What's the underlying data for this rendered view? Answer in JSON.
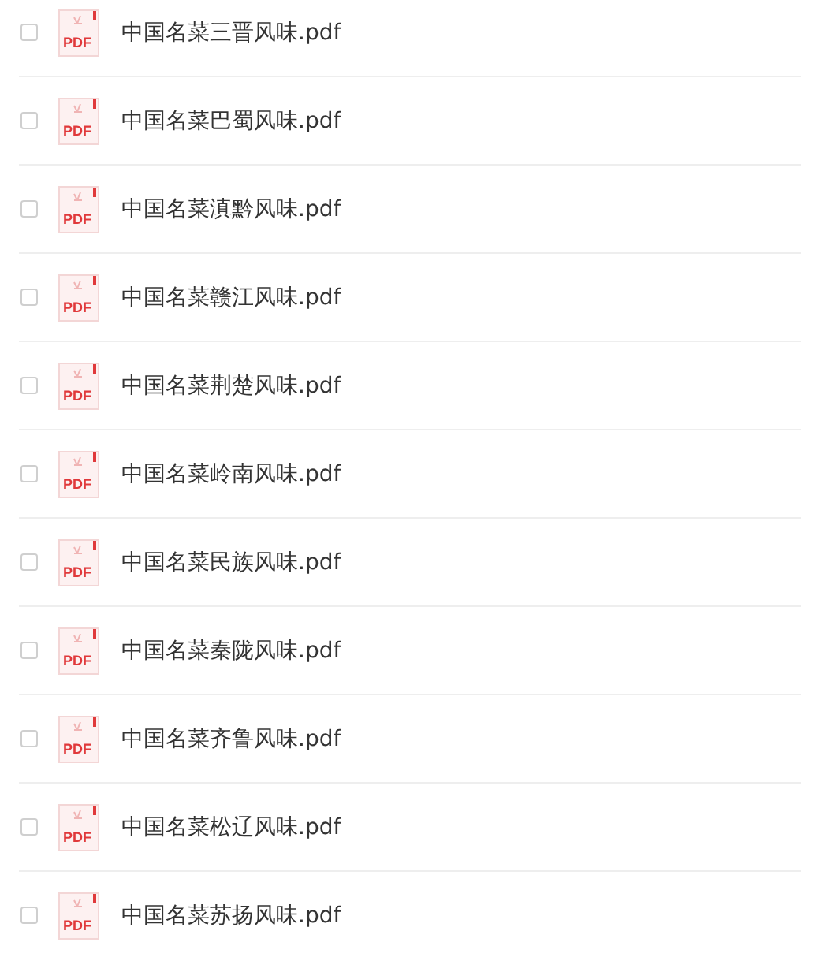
{
  "files": [
    {
      "name": "中国名菜三晋风味.pdf",
      "icon_text": "PDF",
      "checked": false
    },
    {
      "name": "中国名菜巴蜀风味.pdf",
      "icon_text": "PDF",
      "checked": false
    },
    {
      "name": "中国名菜滇黔风味.pdf",
      "icon_text": "PDF",
      "checked": false
    },
    {
      "name": "中国名菜赣江风味.pdf",
      "icon_text": "PDF",
      "checked": false
    },
    {
      "name": "中国名菜荆楚风味.pdf",
      "icon_text": "PDF",
      "checked": false
    },
    {
      "name": "中国名菜岭南风味.pdf",
      "icon_text": "PDF",
      "checked": false
    },
    {
      "name": "中国名菜民族风味.pdf",
      "icon_text": "PDF",
      "checked": false
    },
    {
      "name": "中国名菜秦陇风味.pdf",
      "icon_text": "PDF",
      "checked": false
    },
    {
      "name": "中国名菜齐鲁风味.pdf",
      "icon_text": "PDF",
      "checked": false
    },
    {
      "name": "中国名菜松辽风味.pdf",
      "icon_text": "PDF",
      "checked": false
    },
    {
      "name": "中国名菜苏扬风味.pdf",
      "icon_text": "PDF",
      "checked": false
    }
  ]
}
